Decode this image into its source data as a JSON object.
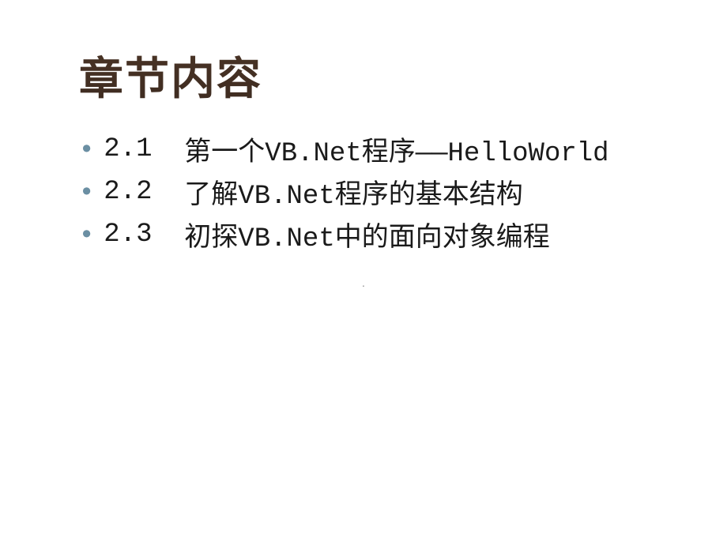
{
  "title": "章节内容",
  "items": [
    {
      "number": "2.1  ",
      "text": "第一个VB.Net程序——HelloWorld"
    },
    {
      "number": "2.2  ",
      "text": "了解VB.Net程序的基本结构"
    },
    {
      "number": "2.3  ",
      "text": "初探VB.Net中的面向对象编程"
    }
  ],
  "centerMark": "."
}
